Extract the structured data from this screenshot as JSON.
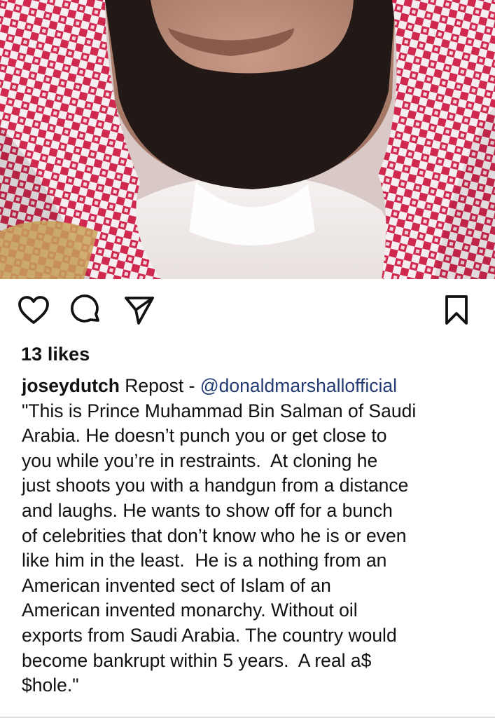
{
  "post": {
    "image": {
      "description_icon": "photo"
    },
    "actions": {
      "like_icon": "heart-outline-icon",
      "comment_icon": "comment-bubble-icon",
      "share_icon": "paper-plane-icon",
      "save_icon": "bookmark-icon"
    },
    "likes": "13 likes",
    "caption": {
      "username": "joseydutch",
      "repost_prefix": " Repost - ",
      "mention": "@donaldmarshallofficial",
      "lines": [
        "\"This is Prince Muhammad Bin Salman of Saudi",
        "Arabia. He doesn’t punch you or get close to",
        "you while you’re in restraints.  At cloning he",
        "just shoots you with a handgun from a distance",
        "and laughs. He wants to show off for a bunch",
        "of celebrities that don’t know who he is or even",
        "like him in the least.  He is a nothing from an",
        "American invented sect of Islam of an",
        "American invented monarchy. Without oil",
        "exports from Saudi Arabia. The country would",
        "become bankrupt within 5 years.  A real a$",
        "$hole.\""
      ]
    }
  },
  "colors": {
    "text": "#111111",
    "mention": "#223b75",
    "divider": "#dcdcdc",
    "background": "#ffffff"
  }
}
